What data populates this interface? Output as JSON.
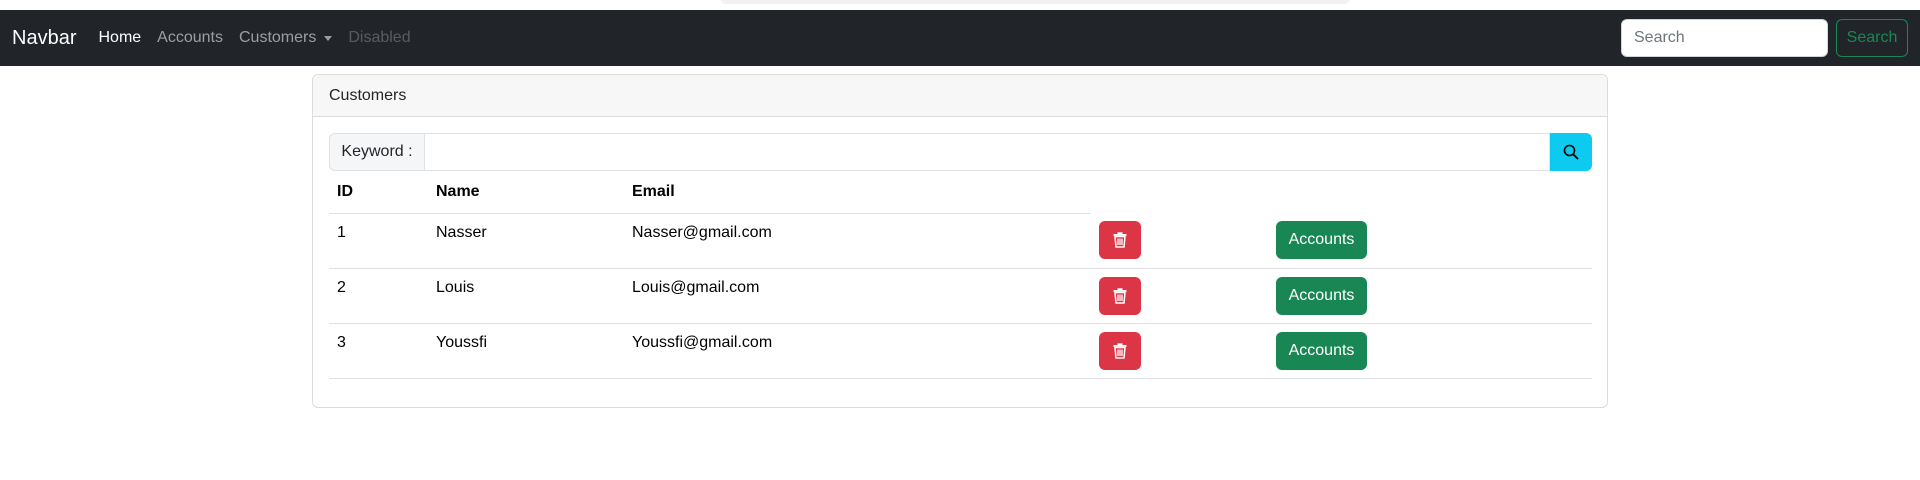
{
  "navbar": {
    "brand": "Navbar",
    "links": [
      {
        "label": "Home",
        "state": "active"
      },
      {
        "label": "Accounts",
        "state": "normal"
      },
      {
        "label": "Customers",
        "state": "dropdown"
      },
      {
        "label": "Disabled",
        "state": "disabled"
      }
    ],
    "search_placeholder": "Search",
    "search_button": "Search"
  },
  "card": {
    "title": "Customers",
    "keyword_label": "Keyword :",
    "keyword_value": "",
    "search_icon": "search-icon"
  },
  "table": {
    "headers": [
      "ID",
      "Name",
      "Email"
    ],
    "rows": [
      {
        "id": "1",
        "name": "Nasser",
        "email": "Nasser@gmail.com",
        "action_label": "Accounts"
      },
      {
        "id": "2",
        "name": "Louis",
        "email": "Louis@gmail.com",
        "action_label": "Accounts"
      },
      {
        "id": "3",
        "name": "Youssfi",
        "email": "Youssfi@gmail.com",
        "action_label": "Accounts"
      }
    ],
    "delete_icon": "trash-icon"
  },
  "colors": {
    "navbar_bg": "#212529",
    "success": "#198754",
    "danger": "#dc3545",
    "info": "#0dcaf0"
  }
}
